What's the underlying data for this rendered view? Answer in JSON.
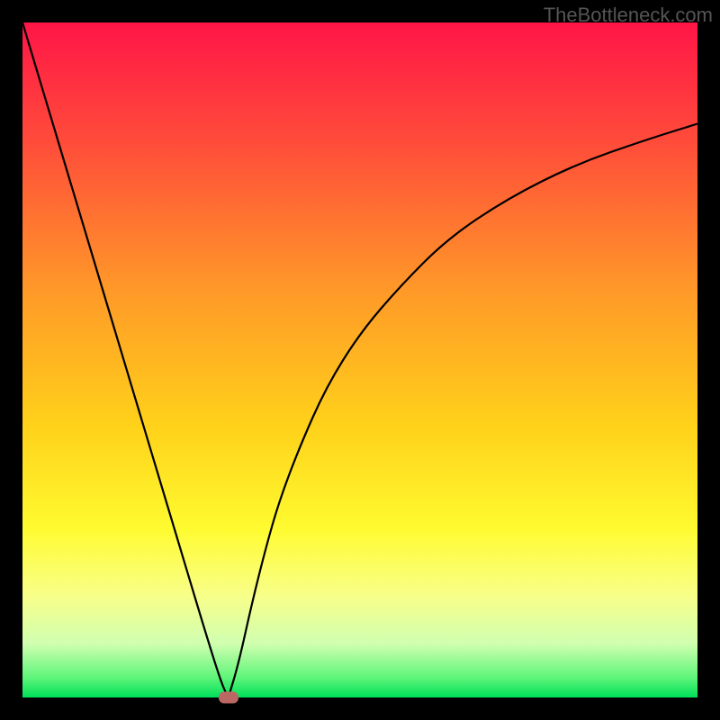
{
  "watermark": "TheBottleneck.com",
  "chart_data": {
    "type": "line",
    "title": "",
    "xlabel": "",
    "ylabel": "",
    "xlim": [
      0,
      100
    ],
    "ylim": [
      0,
      100
    ],
    "gradient_stops": [
      {
        "offset": 0,
        "color": "#ff1547"
      },
      {
        "offset": 18,
        "color": "#ff4d3a"
      },
      {
        "offset": 40,
        "color": "#ff9a28"
      },
      {
        "offset": 60,
        "color": "#ffd21a"
      },
      {
        "offset": 75,
        "color": "#fffb30"
      },
      {
        "offset": 85,
        "color": "#f8ff8a"
      },
      {
        "offset": 92,
        "color": "#d0ffb0"
      },
      {
        "offset": 97,
        "color": "#60f57a"
      },
      {
        "offset": 100,
        "color": "#00e05a"
      }
    ],
    "series": [
      {
        "name": "left-branch",
        "x": [
          0,
          3,
          6,
          9,
          12,
          15,
          18,
          21,
          24,
          27,
          29.5,
          30.5
        ],
        "y": [
          100,
          90,
          80,
          70,
          60,
          50,
          40,
          30,
          20,
          10,
          2,
          0
        ]
      },
      {
        "name": "right-branch",
        "x": [
          30.5,
          32,
          34,
          36,
          38,
          41,
          45,
          50,
          56,
          63,
          72,
          82,
          92,
          100
        ],
        "y": [
          0,
          5,
          14,
          22,
          29,
          37,
          46,
          54,
          61,
          68,
          74,
          79,
          82.5,
          85
        ]
      }
    ],
    "marker": {
      "x": 30.5,
      "y": 0,
      "color": "#bb6864"
    }
  }
}
